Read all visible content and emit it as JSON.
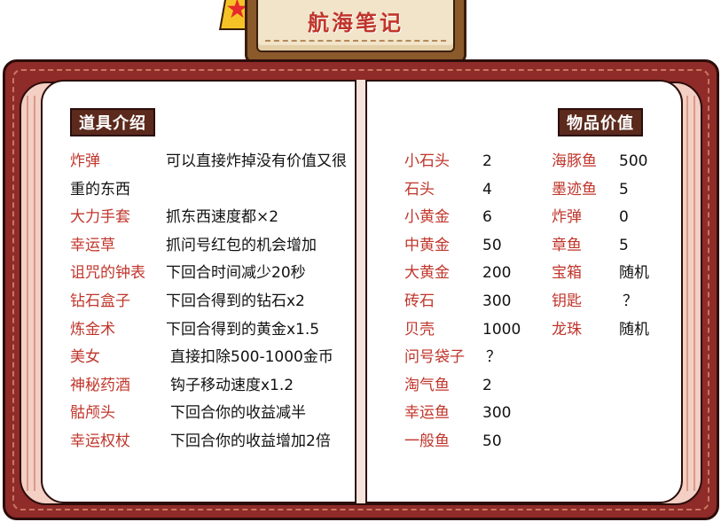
{
  "header": {
    "title": "航海笔记"
  },
  "colors": {
    "accent_red": "#c0352b",
    "cover": "#8f2b28",
    "tag_bg": "#5b2a1c",
    "page": "#ffffff"
  },
  "icons": {
    "badge": "star-icon"
  },
  "left_page": {
    "heading": "道具介绍",
    "items": [
      {
        "name": "炸弹",
        "desc": "可以直接炸掉没有价值又很重的东西"
      },
      {
        "name": "大力手套",
        "desc": "抓东西速度都×2"
      },
      {
        "name": "幸运草",
        "desc": "抓问号红包的机会增加"
      },
      {
        "name": "诅咒的钟表",
        "desc": "下回合时间减少20秒"
      },
      {
        "name": "钻石盒子",
        "desc": "下回合得到的钻石x2"
      },
      {
        "name": "炼金术",
        "desc": "下回合得到的黄金x1.5"
      },
      {
        "name": "美女",
        "desc": "直接扣除500-1000金币"
      },
      {
        "name": "神秘药酒",
        "desc": "钩子移动速度x1.2"
      },
      {
        "name": "骷颅头",
        "desc": "下回合你的收益减半"
      },
      {
        "name": "幸运权杖",
        "desc": "下回合你的收益增加2倍"
      }
    ]
  },
  "right_page": {
    "heading": "物品价值",
    "column1": [
      {
        "name": "小石头",
        "value": "2"
      },
      {
        "name": "石头",
        "value": "4"
      },
      {
        "name": "小黄金",
        "value": "6"
      },
      {
        "name": "中黄金",
        "value": "50"
      },
      {
        "name": "大黄金",
        "value": "200"
      },
      {
        "name": "砖石",
        "value": "300"
      },
      {
        "name": "贝壳",
        "value": "1000"
      },
      {
        "name": "问号袋子",
        "value": "？"
      },
      {
        "name": "淘气鱼",
        "value": "2"
      },
      {
        "name": "幸运鱼",
        "value": "300"
      },
      {
        "name": "一般鱼",
        "value": "50"
      }
    ],
    "column2": [
      {
        "name": "海豚鱼",
        "value": "500"
      },
      {
        "name": "墨迹鱼",
        "value": "5"
      },
      {
        "name": "炸弹",
        "value": "0"
      },
      {
        "name": "章鱼",
        "value": "5"
      },
      {
        "name": "宝箱",
        "value": "随机"
      },
      {
        "name": "钥匙",
        "value": "？"
      },
      {
        "name": "龙珠",
        "value": "随机"
      }
    ]
  }
}
